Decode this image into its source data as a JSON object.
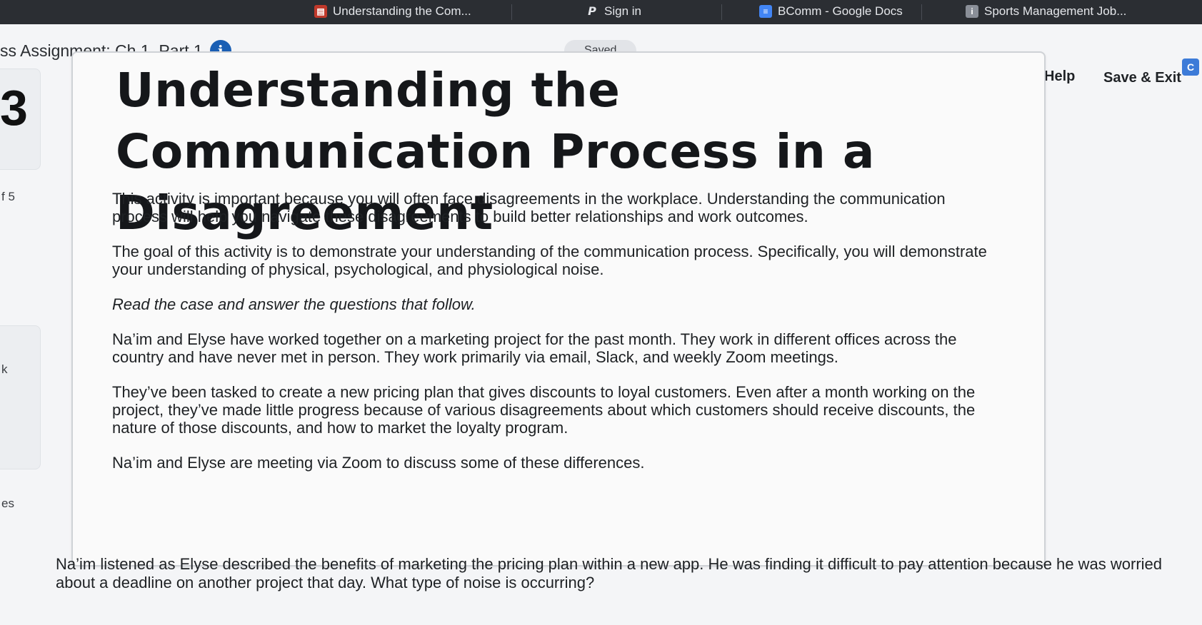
{
  "bookmarks": [
    {
      "label": "Understanding the Com...",
      "icon": "book-icon",
      "color": "#c0392b"
    },
    {
      "label": "Sign in",
      "icon": "pinterest-icon",
      "color": "#e4e6ea"
    },
    {
      "label": "BComm - Google Docs",
      "icon": "docs-icon",
      "color": "#4285f4"
    },
    {
      "label": "Sports Management Job...",
      "icon": "job-icon",
      "color": "#8a8f98"
    }
  ],
  "header": {
    "assignment_title": "ss Assignment: Ch 1, Part 1",
    "saved": "Saved",
    "help": "Help",
    "save_exit": "Save & Exit",
    "profile_initial": "C"
  },
  "rail": {
    "step_number": "3",
    "item_label": "f 5",
    "item_label_2": "k",
    "item_label_3": "es"
  },
  "main": {
    "title": "Understanding the Communication Process in a Disagreement",
    "paragraphs": [
      "This activity is important because you will often face disagreements in the workplace. Understanding the communication process will help you navigate these disagreements to build better relationships and work outcomes.",
      "The goal of this activity is to demonstrate your understanding of the communication process. Specifically, you will demonstrate your understanding of physical, psychological, and physiological noise.",
      "Read the case and answer the questions that follow.",
      "Na’im and Elyse have worked together on a marketing project for the past month. They work in different offices across the country and have never met in person. They work primarily via email, Slack, and weekly Zoom meetings.",
      "They’ve been tasked to create a new pricing plan that gives discounts to loyal customers. Even after a month working on the project, they’ve made little progress because of various disagreements about which customers should receive discounts, the nature of those discounts, and how to market the loyalty program.",
      "Na’im and Elyse are meeting via Zoom to discuss some of these differences."
    ]
  },
  "question": {
    "text": "Na’im listened as Elyse described the benefits of marketing the pricing plan within a new app. He was finding it difficult to pay attention because he was worried about a deadline on another project that day. What type of noise is occurring?"
  },
  "colors": {
    "accent": "#1a5fb4",
    "bookmark_bar": "#2b2e33",
    "page_bg": "#f4f5f7"
  }
}
